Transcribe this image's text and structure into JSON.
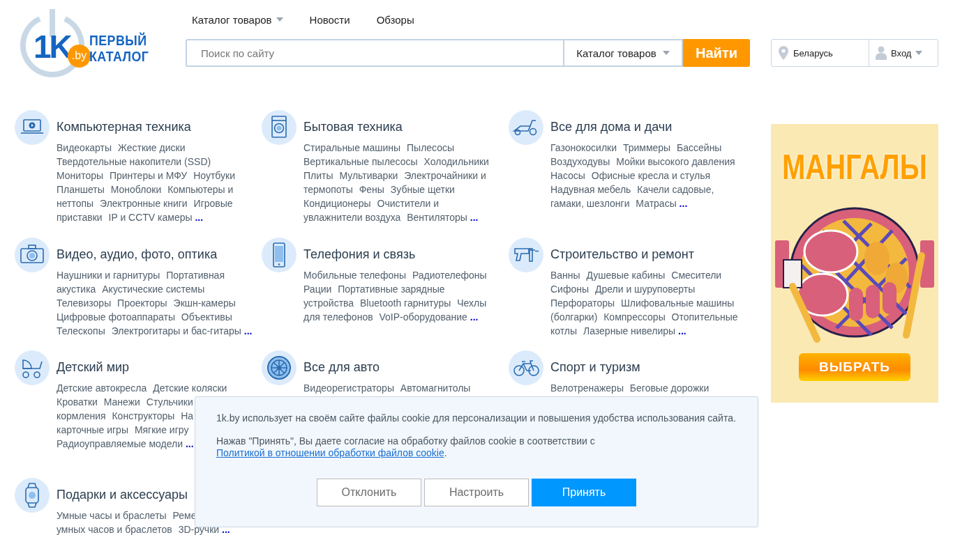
{
  "logo": {
    "mark": "1K",
    "domain": ".by",
    "name_line_1": "ПЕРВЫЙ",
    "name_line_2": "КАТАЛОГ"
  },
  "nav": [
    {
      "label": "Каталог товаров",
      "dropdown": true
    },
    {
      "label": "Новости",
      "dropdown": false
    },
    {
      "label": "Обзоры",
      "dropdown": false
    }
  ],
  "search": {
    "placeholder": "Поиск по сайту",
    "scope": "Каталог товаров",
    "button": "Найти"
  },
  "region": "Беларусь",
  "login": "Вход",
  "categories": [
    {
      "title": "Компьютерная техника",
      "links": [
        {
          "label": "Видеокарты"
        },
        {
          "label": "Жесткие диски"
        },
        {
          "label": "Твердотельные накопители (SSD)"
        },
        {
          "label": "Мониторы"
        },
        {
          "label": "Принтеры и МФУ"
        },
        {
          "label": "Ноутбуки"
        },
        {
          "label": "Планшеты"
        },
        {
          "label": "Моноблоки"
        },
        {
          "label": "Компьютеры и"
        },
        {
          "label": "неттопы"
        },
        {
          "label": "Электронные книги"
        },
        {
          "label": "Игровые"
        },
        {
          "label": "приставки"
        },
        {
          "label": "IP и CCTV камеры"
        }
      ],
      "more": "..."
    },
    {
      "title": "Бытовая техника",
      "links": [
        {
          "label": "Стиральные машины"
        },
        {
          "label": "Пылесосы"
        },
        {
          "label": "Вертикальные пылесосы"
        },
        {
          "label": "Холодильники"
        },
        {
          "label": "Плиты"
        },
        {
          "label": "Мультиварки"
        },
        {
          "label": "Электрочайники и"
        },
        {
          "label": "термопоты"
        },
        {
          "label": "Фены"
        },
        {
          "label": "Зубные щетки"
        },
        {
          "label": "Кондиционеры"
        },
        {
          "label": "Очистители и"
        },
        {
          "label": "увлажнители воздуха"
        },
        {
          "label": "Вентиляторы"
        }
      ],
      "more": "..."
    },
    {
      "title": "Все для дома и дачи",
      "links": [
        {
          "label": "Газонокосилки"
        },
        {
          "label": "Триммеры"
        },
        {
          "label": "Бассейны"
        },
        {
          "label": "Воздуходувы"
        },
        {
          "label": "Мойки высокого давления"
        },
        {
          "label": "Насосы"
        },
        {
          "label": "Офисные кресла и стулья"
        },
        {
          "label": "Надувная мебель"
        },
        {
          "label": "Качели садовые,"
        },
        {
          "label": "гамаки, шезлонги"
        },
        {
          "label": "Матрасы"
        }
      ],
      "more": "..."
    },
    {
      "title": "Видео, аудио, фото, оптика",
      "links": [
        {
          "label": "Наушники и гарнитуры"
        },
        {
          "label": "Портативная"
        },
        {
          "label": "акустика"
        },
        {
          "label": "Акустические системы"
        },
        {
          "label": "Телевизоры"
        },
        {
          "label": "Проекторы"
        },
        {
          "label": "Экшн-камеры"
        },
        {
          "label": "Цифровые фотоаппараты"
        },
        {
          "label": "Объективы"
        },
        {
          "label": "Телескопы"
        },
        {
          "label": "Электрогитары и бас-гитары"
        }
      ],
      "more": "..."
    },
    {
      "title": "Телефония и связь",
      "links": [
        {
          "label": "Мобильные телефоны"
        },
        {
          "label": "Радиотелефоны"
        },
        {
          "label": "Рации"
        },
        {
          "label": "Портативные зарядные"
        },
        {
          "label": "устройства"
        },
        {
          "label": "Bluetooth гарнитуры"
        },
        {
          "label": "Чехлы"
        },
        {
          "label": "для телефонов"
        },
        {
          "label": "VoIP-оборудование"
        }
      ],
      "more": "..."
    },
    {
      "title": "Строительство и ремонт",
      "links": [
        {
          "label": "Ванны"
        },
        {
          "label": "Душевые кабины"
        },
        {
          "label": "Смесители"
        },
        {
          "label": "Сифоны"
        },
        {
          "label": "Дрели и шуруповерты"
        },
        {
          "label": "Перфораторы"
        },
        {
          "label": "Шлифовальные машины"
        },
        {
          "label": "(болгарки)"
        },
        {
          "label": "Компрессоры"
        },
        {
          "label": "Отопительные"
        },
        {
          "label": "котлы"
        },
        {
          "label": "Лазерные нивелиры"
        }
      ],
      "more": "..."
    },
    {
      "title": "Детский мир",
      "links": [
        {
          "label": "Детские автокресла"
        },
        {
          "label": "Детские коляски"
        },
        {
          "label": "Кроватки"
        },
        {
          "label": "Манежи"
        },
        {
          "label": "Стульчики",
          "cut": true
        },
        {
          "label": "кормления"
        },
        {
          "label": "Конструкторы"
        },
        {
          "label": "На",
          "cut": true
        },
        {
          "label": "карточные игры"
        },
        {
          "label": "Мягкие игру",
          "cut": true
        },
        {
          "label": "Радиоуправляемые модели"
        }
      ],
      "more": "..."
    },
    {
      "title": "Все для авто",
      "links": [
        {
          "label": "Видеорегистраторы"
        },
        {
          "label": "Автомагнитолы"
        }
      ]
    },
    {
      "title": "Спорт и туризм",
      "links": [
        {
          "label": "Велотренажеры"
        },
        {
          "label": "Беговые дорожки"
        }
      ]
    },
    {
      "title": "Подарки и аксессуары",
      "links": [
        {
          "label": "Умные часы и браслеты"
        },
        {
          "label": "Реме",
          "cut": true
        },
        {
          "label": "умных часов и браслетов"
        },
        {
          "label": "3D-ручки"
        }
      ],
      "more": "..."
    }
  ],
  "ad": {
    "headline": "МАНГАЛЫ",
    "button": "ВЫБРАТЬ"
  },
  "cookie": {
    "text": "1k.by использует на своём сайте файлы cookie для персонализации и повышения удобства использования сайта.",
    "consent_text": "Нажав \"Принять\", Вы даете согласие на обработку файлов cookie в соответствии с ",
    "policy_link": "Политикой в отношении обработки файлов cookie",
    "consent_end": ".",
    "buttons": [
      {
        "label": "Отклонить",
        "kind": "secondary"
      },
      {
        "label": "Настроить",
        "kind": "secondary"
      },
      {
        "label": "Принять",
        "kind": "primary"
      }
    ]
  }
}
